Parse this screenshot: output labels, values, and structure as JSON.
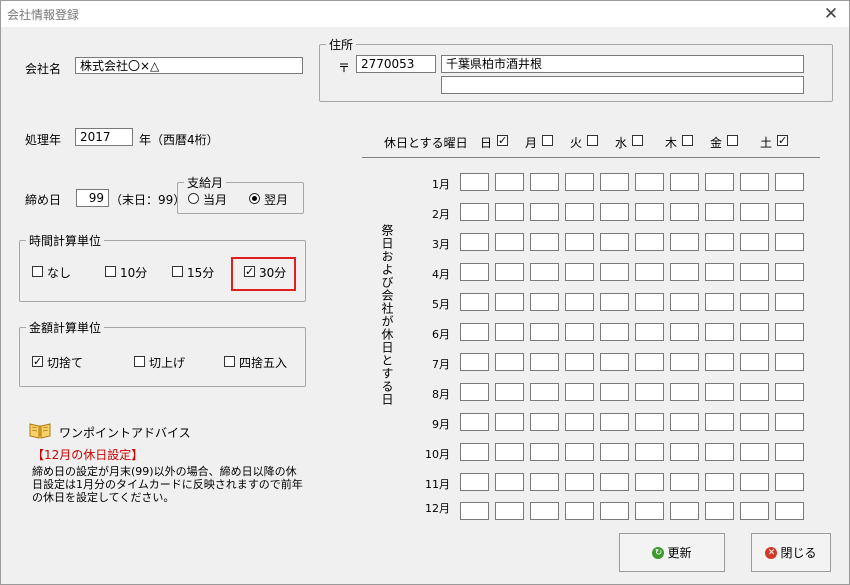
{
  "window": {
    "title": "会社情報登録",
    "close_icon": "close-icon"
  },
  "company": {
    "label": "会社名",
    "value": "株式会社〇×△"
  },
  "address": {
    "legend": "住所",
    "postal_mark": "〒",
    "postal_code": "2770053",
    "line1": "千葉県柏市酒井根",
    "line2": ""
  },
  "year": {
    "label": "処理年",
    "value": "2017",
    "suffix": "年（西暦4桁）"
  },
  "closing": {
    "label": "締め日",
    "value": "99",
    "suffix": "（末日：99）"
  },
  "payday": {
    "legend": "支給月",
    "options": [
      {
        "label": "当月",
        "selected": false
      },
      {
        "label": "翌月",
        "selected": true
      }
    ]
  },
  "time_unit": {
    "legend": "時間計算単位",
    "options": [
      {
        "label": "なし",
        "checked": false
      },
      {
        "label": "10分",
        "checked": false
      },
      {
        "label": "15分",
        "checked": false
      },
      {
        "label": "30分",
        "checked": true
      }
    ],
    "highlight_color": "#e02020"
  },
  "amount_unit": {
    "legend": "金額計算単位",
    "options": [
      {
        "label": "切捨て",
        "checked": true
      },
      {
        "label": "切上げ",
        "checked": false
      },
      {
        "label": "四捨五入",
        "checked": false
      }
    ]
  },
  "advice": {
    "icon": "book-icon",
    "title": "ワンポイントアドバイス",
    "heading": "【12月の休日設定】",
    "body": "締め日の設定が月末(99)以外の場合、締め日以降の休日設定は1月分のタイムカードに反映されますので前年の休日を設定してください。",
    "heading_color": "#cc0000"
  },
  "holidays": {
    "label": "休日とする曜日",
    "weekdays": [
      {
        "label": "日",
        "checked": true
      },
      {
        "label": "月",
        "checked": false
      },
      {
        "label": "火",
        "checked": false
      },
      {
        "label": "水",
        "checked": false
      },
      {
        "label": "木",
        "checked": false
      },
      {
        "label": "金",
        "checked": false
      },
      {
        "label": "土",
        "checked": true
      }
    ],
    "vertical_label": "祭日および会社が休日とする日",
    "months": [
      "1月",
      "2月",
      "3月",
      "4月",
      "5月",
      "6月",
      "7月",
      "8月",
      "9月",
      "10月",
      "11月",
      "12月"
    ]
  },
  "buttons": {
    "update": {
      "label": "更新",
      "icon": "refresh-icon",
      "icon_color": "#3a9a2a"
    },
    "close": {
      "label": "閉じる",
      "icon": "close-circle-icon",
      "icon_color": "#d03a2a"
    }
  }
}
